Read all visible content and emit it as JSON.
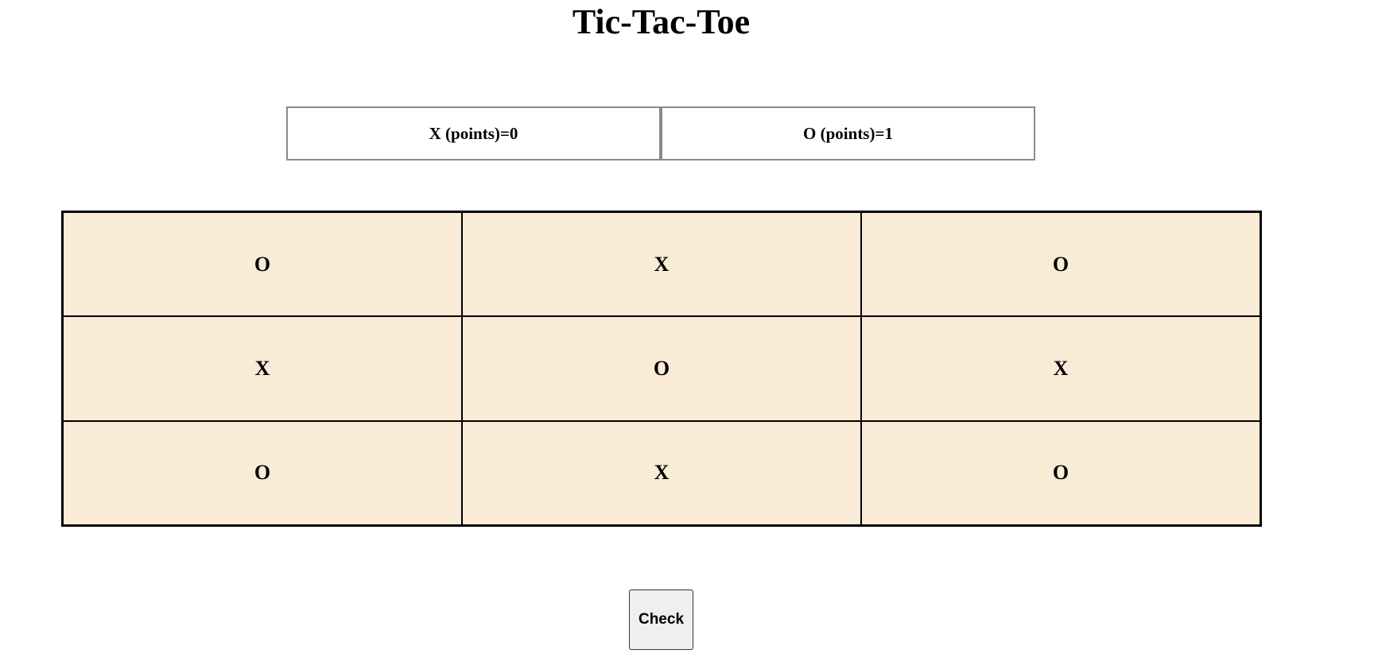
{
  "page": {
    "title": "Tic-Tac-Toe"
  },
  "scoreboard": {
    "x_label": "X (points)=0",
    "o_label": "O (points)=1"
  },
  "board": {
    "cells": [
      "O",
      "X",
      "O",
      "X",
      "O",
      "X",
      "O",
      "X",
      "O"
    ],
    "background_color": "#faebd7"
  },
  "controls": {
    "check_label": "Check"
  }
}
